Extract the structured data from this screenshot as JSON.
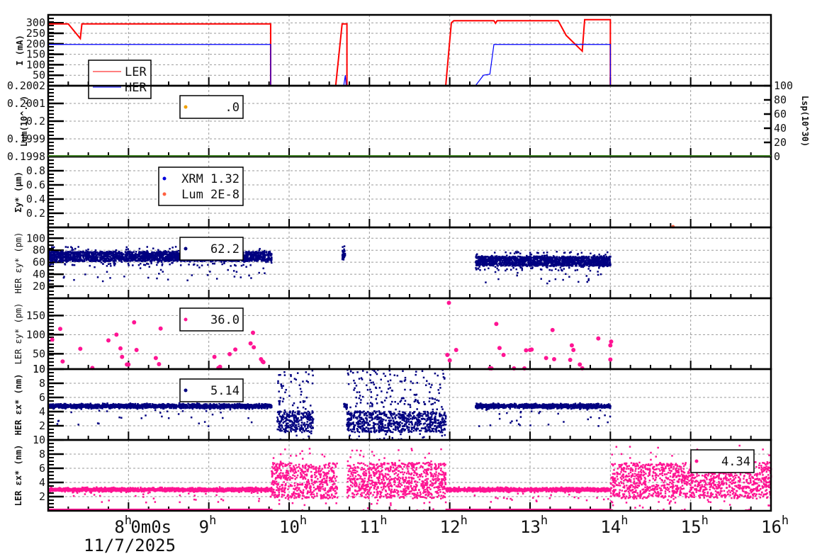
{
  "chart_data": [
    {
      "type": "line",
      "panel": "current",
      "ylabel": "I (mA)",
      "ylim": [
        0,
        338
      ],
      "yticks": [
        50,
        100,
        150,
        200,
        250,
        300
      ],
      "legend": {
        "placement": "top-left",
        "entries": [
          {
            "label": "LER",
            "color": "#ff0000"
          },
          {
            "label": "HER",
            "color": "#0000ff"
          }
        ]
      },
      "series": [
        {
          "name": "LER",
          "color": "#ff0000",
          "points": [
            [
              7.0,
              295
            ],
            [
              7.25,
              295
            ],
            [
              7.4,
              225
            ],
            [
              7.42,
              295
            ],
            [
              9.77,
              295
            ],
            [
              9.77,
              0
            ],
            [
              10.58,
              0
            ],
            [
              10.66,
              295
            ],
            [
              10.72,
              295
            ],
            [
              10.72,
              0
            ],
            [
              11.95,
              0
            ],
            [
              12.02,
              300
            ],
            [
              12.05,
              310
            ],
            [
              12.55,
              310
            ],
            [
              12.57,
              298
            ],
            [
              12.59,
              310
            ],
            [
              13.35,
              310
            ],
            [
              13.45,
              240
            ],
            [
              13.65,
              165
            ],
            [
              13.68,
              315
            ],
            [
              14.0,
              315
            ],
            [
              14.0,
              0
            ]
          ]
        },
        {
          "name": "HER",
          "color": "#0000ff",
          "points": [
            [
              7.0,
              197
            ],
            [
              9.77,
              197
            ],
            [
              9.77,
              0
            ],
            [
              10.68,
              0
            ],
            [
              10.7,
              50
            ],
            [
              10.71,
              0
            ],
            [
              12.32,
              0
            ],
            [
              12.42,
              50
            ],
            [
              12.5,
              55
            ],
            [
              12.55,
              197
            ],
            [
              14.0,
              197
            ],
            [
              14.0,
              0
            ]
          ]
        }
      ]
    },
    {
      "type": "line",
      "panel": "luminosity",
      "ylabel": "Lum(10^..)",
      "ylim": [
        0.1998,
        0.2002
      ],
      "yticks": [
        "0.1998",
        "0.1999",
        "0.2",
        "0.2001",
        "0.2002"
      ],
      "y2label": "Lsp(10^30)",
      "y2lim": [
        0,
        100
      ],
      "y2ticks": [
        "0",
        "20",
        "40",
        "60",
        "80",
        "100"
      ],
      "legend": {
        "placement": "top-left",
        "entries": [
          {
            "label": ".0",
            "color": "#f0a000"
          }
        ]
      }
    },
    {
      "type": "scatter",
      "panel": "sigma_y",
      "ylabel": "Σy* (μm)",
      "ylim": [
        0,
        1
      ],
      "yticks": [
        "0.2",
        "0.4",
        "0.6",
        "0.8"
      ],
      "legend": {
        "placement": "top-left",
        "entries": [
          {
            "label": "XRM 1.32",
            "color": "#0000dd"
          },
          {
            "label": "Lum 2E-8",
            "color": "#ff6040"
          }
        ]
      },
      "points": [
        {
          "series": "Lum 2E-8",
          "x": 14.78,
          "y": 0.0
        }
      ]
    },
    {
      "type": "scatter",
      "panel": "HER_eps_y",
      "ylabel": "HER εy* (pm)",
      "ylim": [
        0,
        118
      ],
      "yticks": [
        "20",
        "40",
        "60",
        "80",
        "100"
      ],
      "legend": {
        "placement": "top-left",
        "entries": [
          {
            "label": "62.2",
            "color": "#000080"
          }
        ]
      },
      "segments": [
        {
          "from": 7.0,
          "to": 9.78,
          "mean": 70,
          "spread": 8
        },
        {
          "from": 10.66,
          "to": 10.7,
          "mean": 72,
          "spread": 8
        },
        {
          "from": 12.32,
          "to": 14.0,
          "mean": 62,
          "spread": 8
        }
      ]
    },
    {
      "type": "scatter",
      "panel": "LER_eps_y",
      "ylabel": "LER εy* (pm)",
      "ylim": [
        10,
        195
      ],
      "yticks": [
        "10",
        "50",
        "100",
        "150"
      ],
      "legend": {
        "placement": "top-left",
        "entries": [
          {
            "label": "36.0",
            "color": "#ff1493"
          }
        ]
      },
      "points": [
        [
          7.05,
          87
        ],
        [
          7.15,
          115
        ],
        [
          7.18,
          30
        ],
        [
          7.4,
          63
        ],
        [
          7.55,
          13
        ],
        [
          7.75,
          85
        ],
        [
          7.85,
          100
        ],
        [
          7.9,
          64
        ],
        [
          7.92,
          42
        ],
        [
          7.98,
          22
        ],
        [
          8.0,
          22
        ],
        [
          8.07,
          132
        ],
        [
          8.1,
          60
        ],
        [
          8.34,
          39
        ],
        [
          8.4,
          116
        ],
        [
          8.38,
          23
        ],
        [
          9.07,
          42
        ],
        [
          9.12,
          13
        ],
        [
          9.14,
          16
        ],
        [
          9.26,
          49
        ],
        [
          9.33,
          61
        ],
        [
          9.52,
          77
        ],
        [
          9.55,
          105
        ],
        [
          9.56,
          67
        ],
        [
          9.65,
          36
        ],
        [
          9.67,
          30
        ],
        [
          9.68,
          28
        ],
        [
          11.97,
          47
        ],
        [
          11.99,
          183
        ],
        [
          12.0,
          33
        ],
        [
          12.08,
          60
        ],
        [
          12.5,
          12
        ],
        [
          12.52,
          11
        ],
        [
          12.58,
          128
        ],
        [
          12.62,
          65
        ],
        [
          12.67,
          47
        ],
        [
          12.8,
          11
        ],
        [
          12.93,
          11
        ],
        [
          12.95,
          59
        ],
        [
          13.0,
          60
        ],
        [
          13.02,
          61
        ],
        [
          13.2,
          39
        ],
        [
          13.28,
          112
        ],
        [
          13.3,
          36
        ],
        [
          13.5,
          34
        ],
        [
          13.52,
          72
        ],
        [
          13.54,
          60
        ],
        [
          13.62,
          22
        ],
        [
          13.65,
          12
        ],
        [
          13.85,
          90
        ],
        [
          14.0,
          72
        ],
        [
          14.01,
          82
        ],
        [
          14.0,
          35
        ]
      ]
    },
    {
      "type": "scatter",
      "panel": "HER_eps_x",
      "ylabel": "HER εx* (nm)",
      "ylim": [
        0,
        10
      ],
      "yticks": [
        "2",
        "4",
        "6",
        "8",
        "10"
      ],
      "legend": {
        "placement": "top-left",
        "entries": [
          {
            "label": "5.14",
            "color": "#000080"
          }
        ]
      },
      "segments": [
        {
          "from": 7.0,
          "to": 9.78,
          "mean": 4.8,
          "spread": 0.3
        },
        {
          "from": 9.85,
          "to": 10.3,
          "mean": 2.6,
          "spread": 1.5,
          "outliers": true
        },
        {
          "from": 10.68,
          "to": 10.72,
          "mean": 4.8,
          "spread": 0.5
        },
        {
          "from": 10.72,
          "to": 11.95,
          "mean": 2.6,
          "spread": 1.5,
          "outliers": true
        },
        {
          "from": 12.32,
          "to": 14.0,
          "mean": 4.8,
          "spread": 0.3
        }
      ]
    },
    {
      "type": "scatter",
      "panel": "LER_eps_x",
      "ylabel": "LER εx* (nm)",
      "ylim": [
        0,
        10
      ],
      "yticks": [
        "2",
        "4",
        "6",
        "8",
        "10"
      ],
      "legend": {
        "placement": "top-right",
        "entries": [
          {
            "label": "4.34",
            "color": "#ff1493"
          }
        ]
      },
      "segments": [
        {
          "from": 7.0,
          "to": 9.78,
          "mean": 3.0,
          "spread": 0.25,
          "floor": 0.2
        },
        {
          "from": 9.78,
          "to": 10.6,
          "mean": 4.3,
          "spread": 2.5
        },
        {
          "from": 10.72,
          "to": 11.95,
          "mean": 4.3,
          "spread": 2.5
        },
        {
          "from": 11.95,
          "to": 14.0,
          "mean": 3.0,
          "spread": 0.25,
          "floor": 0.2
        },
        {
          "from": 14.0,
          "to": 16.0,
          "mean": 4.3,
          "spread": 2.5
        }
      ]
    }
  ],
  "x_axis": {
    "range_hours": [
      7,
      16
    ],
    "ticks": [
      {
        "h": 8,
        "label": "8",
        "sup": "h",
        "extra": "0m0s"
      },
      {
        "h": 9,
        "label": "9"
      },
      {
        "h": 10,
        "label": "10"
      },
      {
        "h": 11,
        "label": "11"
      },
      {
        "h": 12,
        "label": "12"
      },
      {
        "h": 13,
        "label": "13"
      },
      {
        "h": 14,
        "label": "14"
      },
      {
        "h": 15,
        "label": "15"
      },
      {
        "h": 16,
        "label": "16"
      }
    ],
    "date": "11/7/2025"
  }
}
